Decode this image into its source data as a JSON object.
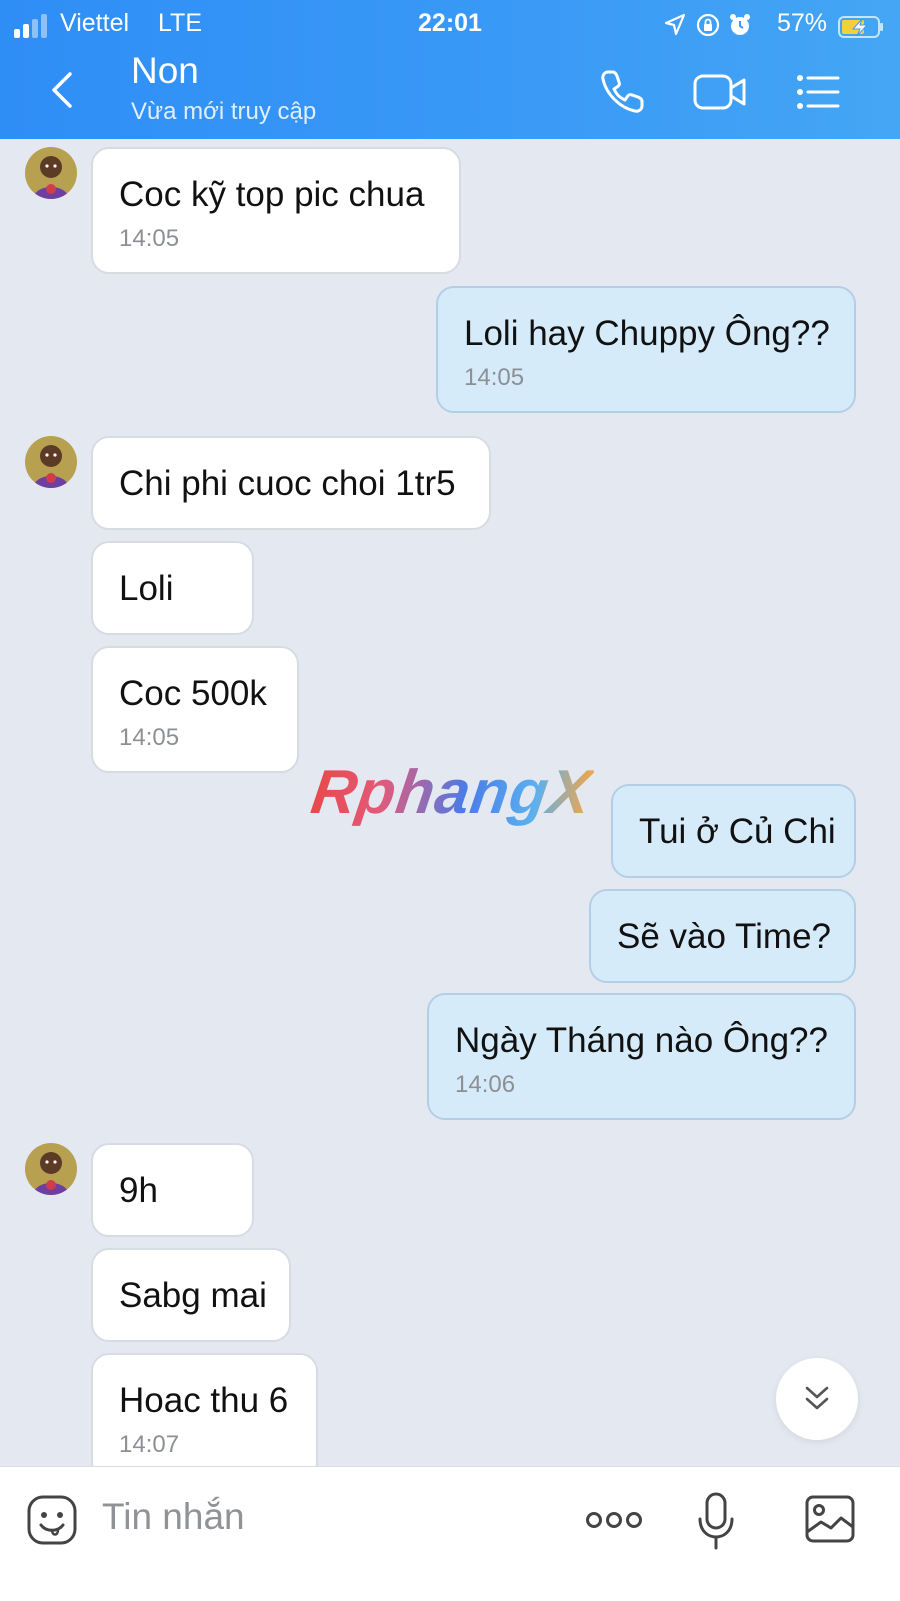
{
  "status_bar": {
    "carrier": "Viettel",
    "network": "LTE",
    "time": "22:01",
    "battery_percent": "57%",
    "icons": [
      "signal-icon",
      "location-arrow-icon",
      "rotation-lock-icon",
      "alarm-icon",
      "battery-charging-icon"
    ]
  },
  "header": {
    "contact_name": "Non",
    "contact_status": "Vừa mới truy cập",
    "icons": [
      "back-chevron-icon",
      "phone-icon",
      "video-camera-icon",
      "menu-list-icon"
    ]
  },
  "messages": [
    {
      "direction": "in",
      "text": "Coc kỹ top pic chua",
      "time": "14:05",
      "avatar": true
    },
    {
      "direction": "out",
      "text": "Loli hay Chuppy Ông??",
      "time": "14:05"
    },
    {
      "direction": "in",
      "text": "Chi phi cuoc choi 1tr5",
      "time": "",
      "avatar": true
    },
    {
      "direction": "in",
      "text": "Loli",
      "time": ""
    },
    {
      "direction": "in",
      "text": "Coc 500k",
      "time": "14:05"
    },
    {
      "direction": "out",
      "text": "Tui ở Củ Chi",
      "time": ""
    },
    {
      "direction": "out",
      "text": "Sẽ vào Time?",
      "time": ""
    },
    {
      "direction": "out",
      "text": "Ngày Tháng nào Ông??",
      "time": "14:06"
    },
    {
      "direction": "in",
      "text": "9h",
      "time": "",
      "avatar": true
    },
    {
      "direction": "in",
      "text": "Sabg mai",
      "time": ""
    },
    {
      "direction": "in",
      "text": "Hoac thu 6",
      "time": "14:07"
    }
  ],
  "watermark": "RphangX",
  "scroll_button_icon": "double-chevron-down-icon",
  "composer": {
    "placeholder": "Tin nhắn",
    "icons": [
      "sticker-smile-icon",
      "more-dots-icon",
      "microphone-icon",
      "image-gallery-icon"
    ]
  },
  "colors": {
    "header_blue": "#3a9af6",
    "chat_background": "#e4e8f0",
    "outgoing_bubble": "#d6ebfa",
    "incoming_bubble": "#ffffff"
  }
}
